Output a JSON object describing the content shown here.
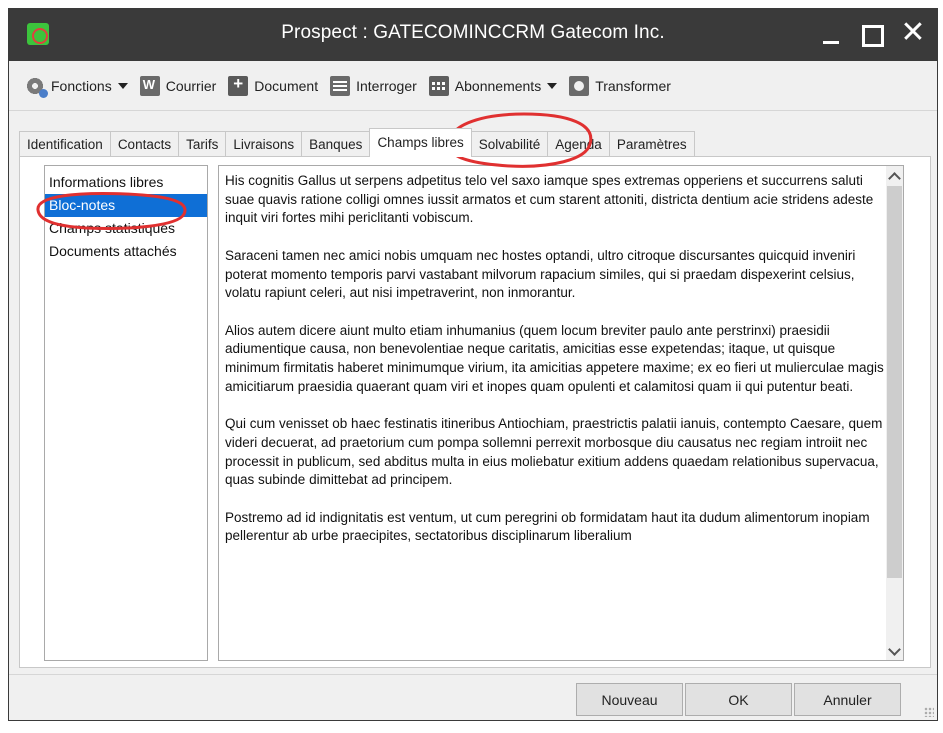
{
  "window": {
    "title": "Prospect : GATECOMINCCRM Gatecom Inc.",
    "close_glyph": "✕"
  },
  "toolbar": {
    "items": [
      {
        "label": "Fonctions",
        "icon": "gear-icon",
        "dropdown": true
      },
      {
        "label": "Courrier",
        "icon": "word-document-icon",
        "dropdown": false
      },
      {
        "label": "Document",
        "icon": "add-document-icon",
        "dropdown": false
      },
      {
        "label": "Interroger",
        "icon": "query-list-icon",
        "dropdown": false
      },
      {
        "label": "Abonnements",
        "icon": "calendar-icon",
        "dropdown": true
      },
      {
        "label": "Transformer",
        "icon": "transform-icon",
        "dropdown": false
      }
    ]
  },
  "tabs": [
    {
      "label": "Identification"
    },
    {
      "label": "Contacts"
    },
    {
      "label": "Tarifs"
    },
    {
      "label": "Livraisons"
    },
    {
      "label": "Banques"
    },
    {
      "label": "Champs libres",
      "active": true
    },
    {
      "label": "Solvabilité"
    },
    {
      "label": "Agenda"
    },
    {
      "label": "Paramètres"
    }
  ],
  "side_list": [
    {
      "label": "Informations libres"
    },
    {
      "label": "Bloc-notes",
      "selected": true
    },
    {
      "label": "Champs statistiques"
    },
    {
      "label": "Documents attachés"
    }
  ],
  "notes": {
    "paragraphs": [
      "His cognitis Gallus ut serpens adpetitus telo vel saxo iamque spes extremas opperiens et succurrens saluti suae quavis ratione colligi omnes iussit armatos et cum starent attoniti, districta dentium acie stridens adeste inquit viri fortes mihi periclitanti vobiscum.",
      "Saraceni tamen nec amici nobis umquam nec hostes optandi, ultro citroque discursantes quicquid inveniri poterat momento temporis parvi vastabant milvorum rapacium similes, qui si praedam dispexerint celsius, volatu rapiunt celeri, aut nisi impetraverint, non inmorantur.",
      "Alios autem dicere aiunt multo etiam inhumanius (quem locum breviter paulo ante perstrinxi) praesidii adiumentique causa, non benevolentiae neque caritatis, amicitias esse expetendas; itaque, ut quisque minimum firmitatis haberet minimumque virium, ita amicitias appetere maxime; ex eo fieri ut mulierculae magis amicitiarum praesidia quaerant quam viri et inopes quam opulenti et calamitosi quam ii qui putentur beati.",
      "Qui cum venisset ob haec festinatis itineribus Antiochiam, praestrictis palatii ianuis, contempto Caesare, quem videri decuerat, ad praetorium cum pompa sollemni perrexit morbosque diu causatus nec regiam introiit nec processit in publicum, sed abditus multa in eius moliebatur exitium addens quaedam relationibus supervacua, quas subinde dimittebat ad principem.",
      "Postremo ad id indignitatis est ventum, ut cum peregrini ob formidatam haut ita dudum alimentorum inopiam pellerentur ab urbe praecipites, sectatoribus disciplinarum liberalium"
    ]
  },
  "footer": {
    "new_label": "Nouveau",
    "ok_label": "OK",
    "cancel_label": "Annuler"
  },
  "colors": {
    "titlebar": "#3a3a3a",
    "selection": "#0f6fd6",
    "annotation": "#e03030"
  }
}
